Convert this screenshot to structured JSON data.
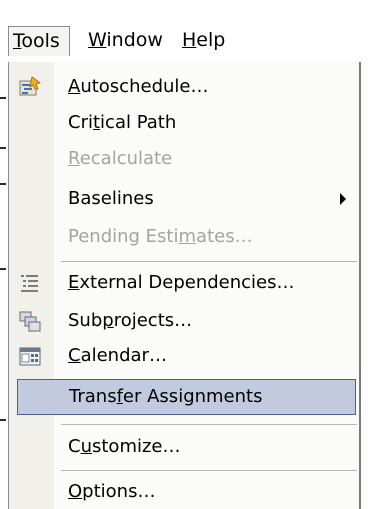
{
  "menubar": {
    "tools": {
      "mnemonic": "T",
      "rest": "ools"
    },
    "window": {
      "mnemonic": "W",
      "rest": "indow"
    },
    "help": {
      "mnemonic": "H",
      "rest": "elp"
    }
  },
  "menu": {
    "autoschedule": {
      "pre": "",
      "mnemonic": "A",
      "post": "utoschedule…",
      "icon": "autoschedule-icon"
    },
    "critical_path": {
      "pre": "Cri",
      "mnemonic": "t",
      "post": "ical Path"
    },
    "recalculate": {
      "pre": "",
      "mnemonic": "R",
      "post": "ecalculate"
    },
    "baselines": {
      "label": "Baselines"
    },
    "pending_estimates": {
      "pre": "Pending Esti",
      "mnemonic": "m",
      "post": "ates…"
    },
    "external_dependencies": {
      "pre": "",
      "mnemonic": "E",
      "post": "xternal Dependencies…",
      "icon": "external-dependencies-icon"
    },
    "subprojects": {
      "pre": "Sub",
      "mnemonic": "p",
      "post": "rojects…",
      "icon": "subprojects-icon"
    },
    "calendar": {
      "pre": "",
      "mnemonic": "C",
      "post": "alendar…",
      "icon": "calendar-icon"
    },
    "transfer_assignments": {
      "pre": "Trans",
      "mnemonic": "f",
      "post": "er Assignments"
    },
    "customize": {
      "pre": "C",
      "mnemonic": "u",
      "post": "stomize…"
    },
    "options": {
      "pre": "",
      "mnemonic": "O",
      "post": "ptions…"
    }
  },
  "colors": {
    "highlight_fill": "#c1cadf",
    "highlight_border": "#4b6290",
    "disabled_text": "#a3a3a3",
    "icon_strip": "#f1f0ea"
  }
}
